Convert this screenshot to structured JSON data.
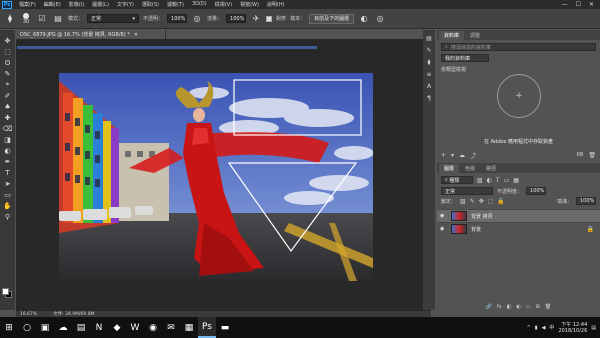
{
  "menu": {
    "items": [
      "檔案(F)",
      "編輯(E)",
      "影像(I)",
      "圖層(L)",
      "文字(Y)",
      "選取(S)",
      "濾鏡(T)",
      "3D(D)",
      "檢視(V)",
      "視窗(W)",
      "說明(H)"
    ],
    "logo": "Ps",
    "window_controls": [
      "—",
      "☐",
      "✕"
    ]
  },
  "options": {
    "brush_size": "30",
    "mode_label": "模式：",
    "mode_value": "正常",
    "opacity_label": "不透明：",
    "opacity_value": "100%",
    "flow_label": "流量：",
    "flow_value": "100%",
    "aligned_label": "對齊",
    "sample_label": "樣本：",
    "sample_value": "目前及下的圖層"
  },
  "document": {
    "tab_title": "DSC_6879.JPG @ 16.7% (背景 拷貝, RGB/8) *",
    "tab_close": "✕",
    "status_zoom": "16.67%",
    "status_file": "文件: 34.9M/69.8M"
  },
  "tools": [
    "✥",
    "⬚",
    "ʘ",
    "✎",
    "⌖",
    "✐",
    "♠",
    "✚",
    "⌫",
    "◨",
    "◐",
    "✒",
    "T",
    "➤",
    "▭",
    "✋",
    "⚲"
  ],
  "libraries": {
    "tabs": [
      "資料庫",
      "調整"
    ],
    "search_placeholder": "搜尋目前的資料庫",
    "library_select": "我的資料庫",
    "view_label": "依類型檢視",
    "hint": "在 Adobe 應用程式中存取資產",
    "kb_label": "KB"
  },
  "layers": {
    "tabs": [
      "圖層",
      "色版",
      "路徑"
    ],
    "filter_value": "種類",
    "blend_mode": "正常",
    "opacity_label": "不透明度：",
    "opacity_value": "100%",
    "lock_label": "鎖定：",
    "fill_label": "填滿：",
    "fill_value": "100%",
    "items": [
      {
        "name": "背景 拷貝",
        "selected": true,
        "locked": false
      },
      {
        "name": "背景",
        "selected": false,
        "locked": true
      }
    ],
    "footer_icons": [
      "🔗",
      "fx",
      "◧",
      "◐",
      "▭",
      "⊞",
      "🗑"
    ]
  },
  "taskbar": {
    "apps": [
      "⊞",
      "○",
      "▣",
      "☁",
      "▤",
      "N",
      "◆",
      "W",
      "◉",
      "✉",
      "▦",
      "Ps",
      "▬"
    ],
    "time": "下午 12:44",
    "date": "2018/10/26",
    "lang": "中"
  },
  "colors": {
    "accent": "#31a8ff",
    "canvas_background": "#282828",
    "selection_stroke": "#ffffff"
  }
}
